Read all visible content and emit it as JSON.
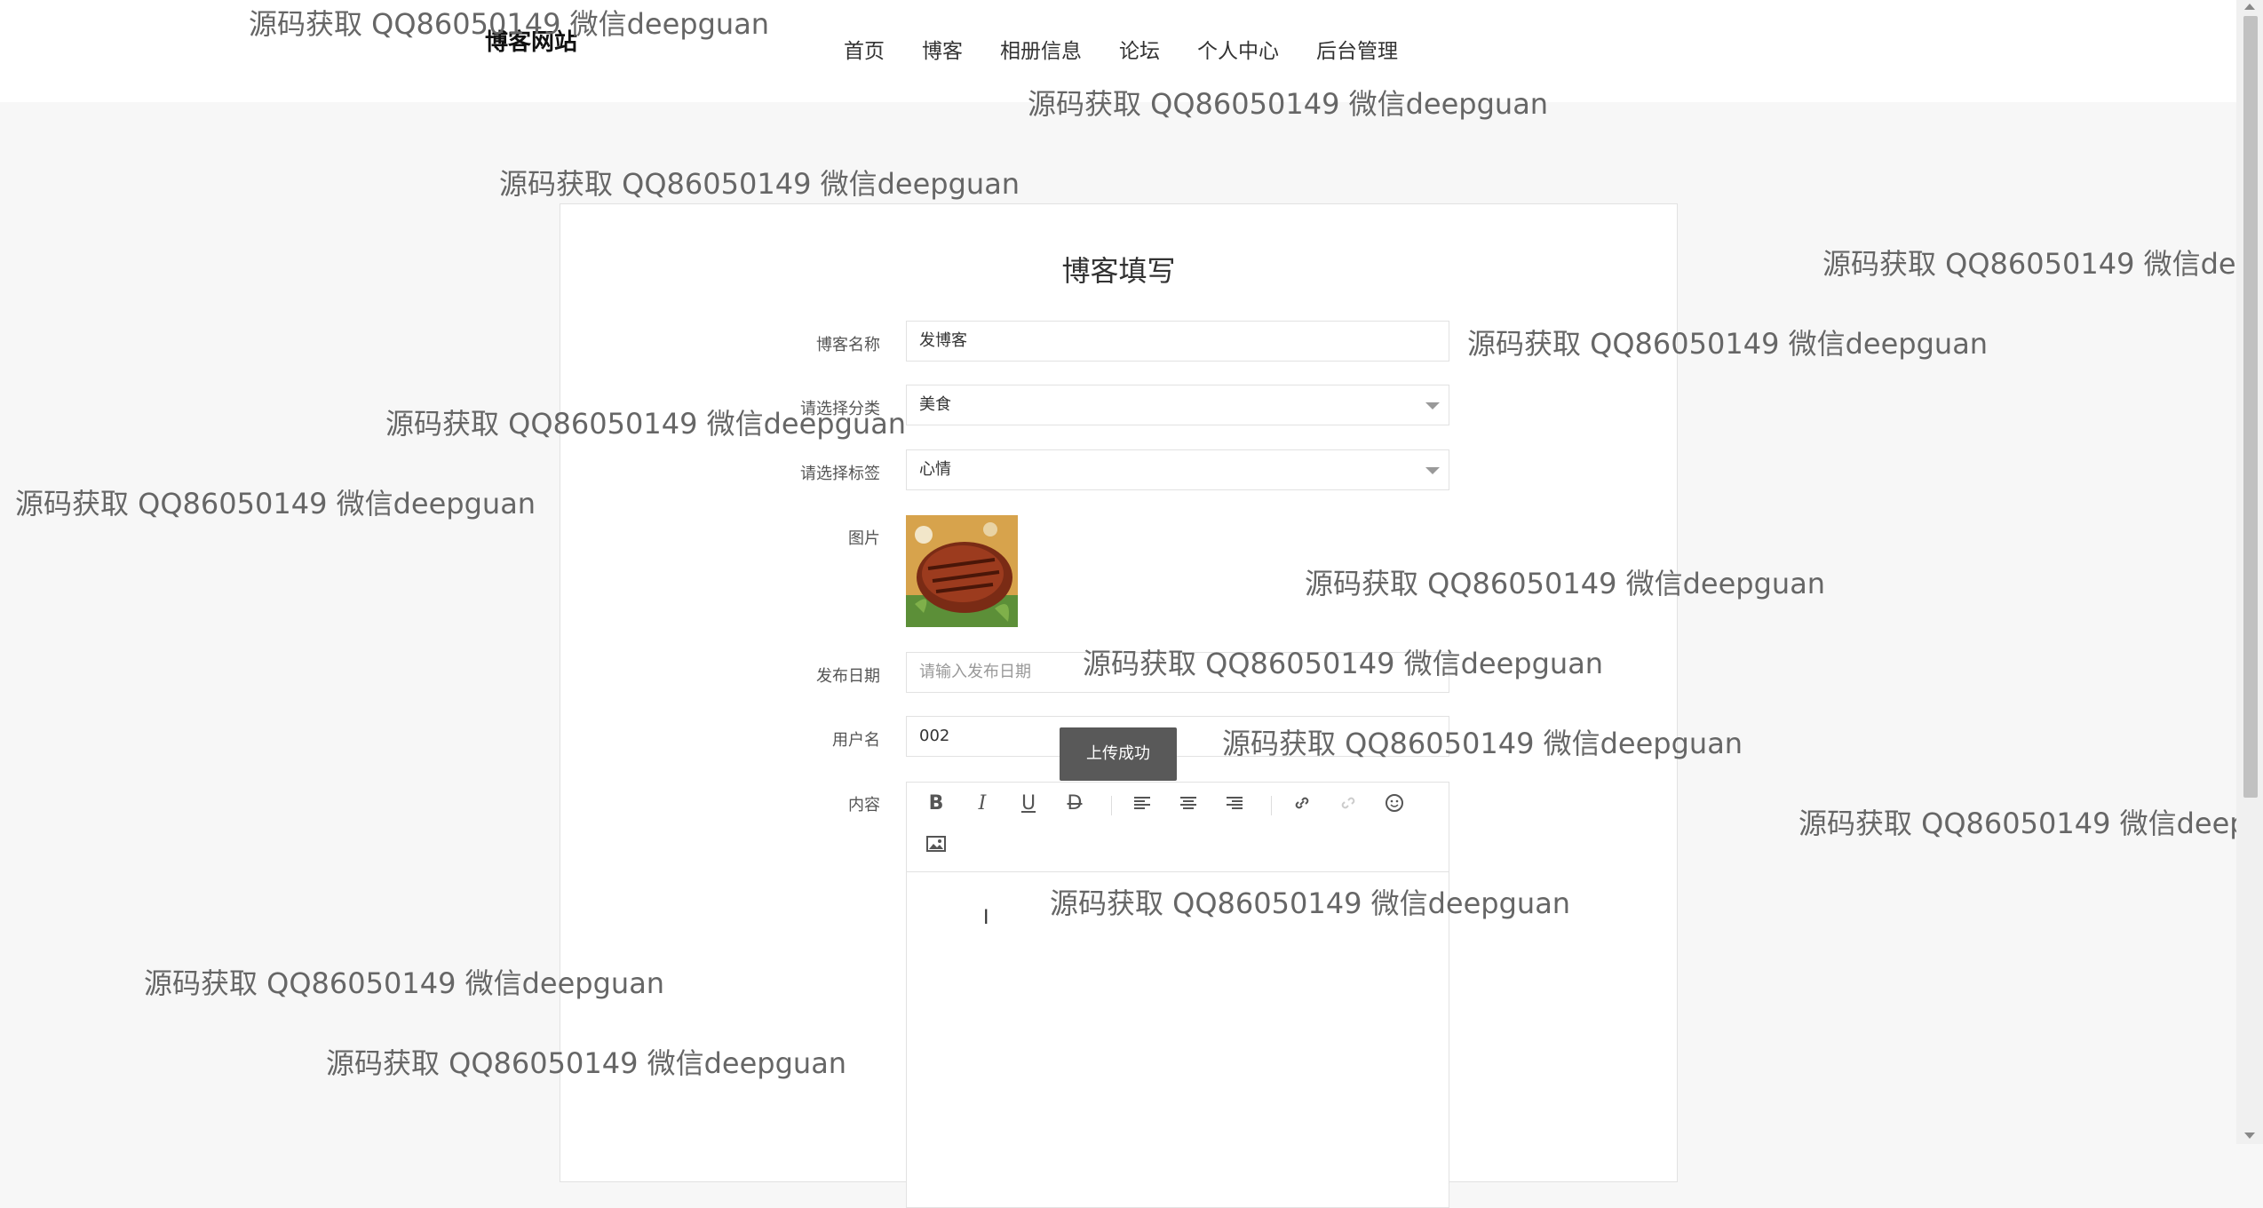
{
  "header": {
    "site_title": "博客网站",
    "nav": [
      "首页",
      "博客",
      "相册信息",
      "论坛",
      "个人中心",
      "后台管理"
    ]
  },
  "form": {
    "title": "博客填写",
    "blog_name": {
      "label": "博客名称",
      "value": "发博客"
    },
    "category": {
      "label": "请选择分类",
      "value": "美食"
    },
    "tag": {
      "label": "请选择标签",
      "value": "心情"
    },
    "image": {
      "label": "图片"
    },
    "publish_date": {
      "label": "发布日期",
      "placeholder": "请输入发布日期"
    },
    "username": {
      "label": "用户名",
      "value": "002"
    },
    "content": {
      "label": "内容"
    },
    "toast": "上传成功"
  },
  "editor_toolbar": {
    "icons": [
      "bold-icon",
      "italic-icon",
      "underline-icon",
      "strikethrough-icon",
      "align-left-icon",
      "align-center-icon",
      "align-right-icon",
      "link-icon",
      "unlink-icon",
      "emoji-icon",
      "image-icon"
    ]
  },
  "watermark": "源码获取 QQ86050149 微信deepguan"
}
